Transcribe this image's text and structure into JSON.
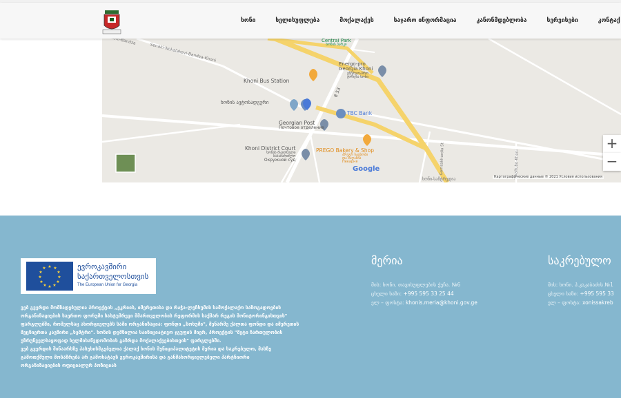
{
  "header": {
    "nav": [
      "ხონი",
      "ხელისუფლება",
      "მოქალაქეს",
      "საჯარო ინფორმაცია",
      "კანონმდებლობა",
      "სერვისები",
      "კონტაქ"
    ]
  },
  "map": {
    "roads": [
      "Senaki-Nokalakevi-Bandza-Khoni",
      "Khoni-Bandza",
      "8 53",
      "Gamsakhurdia St",
      "Tskaltubo-Khoni",
      "ხონი-სამტრედია"
    ],
    "places": {
      "central_park": [
        "Central Park",
        "ხონის პარკი"
      ],
      "energo": [
        "Energo-pro",
        "Georgia Khoni",
        "ენერგო-პრო",
        "ჯორჯია ხონი"
      ],
      "bus_station": "Khoni Bus Station",
      "bus_station_geo": "ხონის ავტოსადგური",
      "tbc": "TBC Bank",
      "post": [
        "Georgian Post",
        "Почтовое отделение"
      ],
      "court": [
        "Khoni District Court",
        "ხონის რაიონული",
        "სასამართლო",
        "Окружной суд"
      ],
      "prego": [
        "PREGO Bakery & Shop",
        "პრეგო საცხობი",
        "და მაღაზია",
        "Пекарня"
      ]
    },
    "google": "Google",
    "attribution": "Картографические данные © 2021   Условия использования",
    "zoom_in": "+",
    "zoom_out": "−"
  },
  "footer": {
    "eu": {
      "line1": "ევროკავშირი",
      "line2": "საქართველოსთვის",
      "line3": "The European Union for Georgia"
    },
    "disclaimer": [
      "ვებ გვერდი მომზადებულია პროექტის „ეკრიის, იმერეთისა და რაჭა-ლეჩხუმის სამოქალაქო საზოგადოების",
      "ორგანიზაციების საერთო ფორუმი სასტუმრევი მმართველობის რეფორმის საქმარ რეგის მონიტორინგისთვის\"",
      "ფარგლებში, რომელსაც ახორციელებს სამი ორგანიზაცია: ფონდი „სოხუმი\", მენარმე ქალთა ფონდი და იმერეთის",
      "მეცნიერთა კავშირი „ხემტრი\". ხონის დემნილია საინიციატივო ჯგუფის მიერ, პროექტის \"მეტი ჩართულობის",
      "უზრუნველსაყოფად ხელმისაწვდომობის გაზრდა მოქალაქეებისთვის\" ფარგლებში.",
      "ვებ გვერდის შინაარსზე პასუხისმგებელია ქალაქ ხონის მუნიციპალიტეტის მერია და საკრებულო, მასზე",
      "გამოთქმული მოსაზრება არ გამოხატავს ევროკავშირისა და განმახორციელებელი პარტნიორი",
      "ორგანიზაციების ოფიციალურ პოზიციას"
    ],
    "meria": {
      "title": "მერია",
      "address": "მის: ხონი. თავისუფლების ქუჩა. №6",
      "phone_label": "ცხელი ხაზი:",
      "phone": "+995 595 33 25 44",
      "email_label": "ელ – ფოსტა:",
      "email": "khonis.meria@khoni.gov.ge"
    },
    "sakrebulo": {
      "title": "საკრებულო",
      "address": "მის: ხონი. პ.კაკაბაძის №1",
      "phone_label": "ცხელი ხაზი:",
      "phone": "+995 595 33",
      "email_label": "ელ – ფოსტა:",
      "email": "xonissakreb"
    }
  },
  "colors": {
    "footer_bg": "#85b7cf",
    "road_yellow": "#f5d36b",
    "eu_blue": "#1f4f9c"
  }
}
